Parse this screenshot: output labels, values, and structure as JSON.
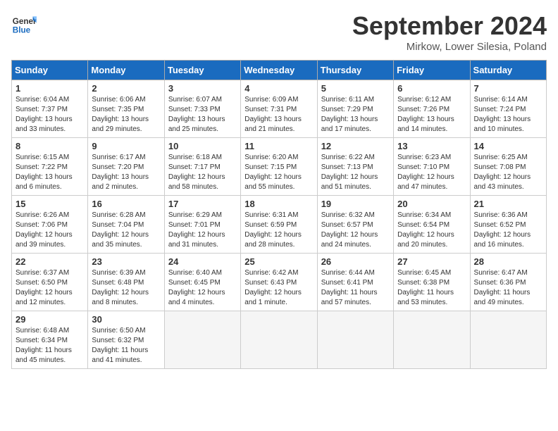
{
  "header": {
    "logo_line1": "General",
    "logo_line2": "Blue",
    "month": "September 2024",
    "location": "Mirkow, Lower Silesia, Poland"
  },
  "weekdays": [
    "Sunday",
    "Monday",
    "Tuesday",
    "Wednesday",
    "Thursday",
    "Friday",
    "Saturday"
  ],
  "weeks": [
    [
      {
        "day": "1",
        "info": "Sunrise: 6:04 AM\nSunset: 7:37 PM\nDaylight: 13 hours\nand 33 minutes."
      },
      {
        "day": "2",
        "info": "Sunrise: 6:06 AM\nSunset: 7:35 PM\nDaylight: 13 hours\nand 29 minutes."
      },
      {
        "day": "3",
        "info": "Sunrise: 6:07 AM\nSunset: 7:33 PM\nDaylight: 13 hours\nand 25 minutes."
      },
      {
        "day": "4",
        "info": "Sunrise: 6:09 AM\nSunset: 7:31 PM\nDaylight: 13 hours\nand 21 minutes."
      },
      {
        "day": "5",
        "info": "Sunrise: 6:11 AM\nSunset: 7:29 PM\nDaylight: 13 hours\nand 17 minutes."
      },
      {
        "day": "6",
        "info": "Sunrise: 6:12 AM\nSunset: 7:26 PM\nDaylight: 13 hours\nand 14 minutes."
      },
      {
        "day": "7",
        "info": "Sunrise: 6:14 AM\nSunset: 7:24 PM\nDaylight: 13 hours\nand 10 minutes."
      }
    ],
    [
      {
        "day": "8",
        "info": "Sunrise: 6:15 AM\nSunset: 7:22 PM\nDaylight: 13 hours\nand 6 minutes."
      },
      {
        "day": "9",
        "info": "Sunrise: 6:17 AM\nSunset: 7:20 PM\nDaylight: 13 hours\nand 2 minutes."
      },
      {
        "day": "10",
        "info": "Sunrise: 6:18 AM\nSunset: 7:17 PM\nDaylight: 12 hours\nand 58 minutes."
      },
      {
        "day": "11",
        "info": "Sunrise: 6:20 AM\nSunset: 7:15 PM\nDaylight: 12 hours\nand 55 minutes."
      },
      {
        "day": "12",
        "info": "Sunrise: 6:22 AM\nSunset: 7:13 PM\nDaylight: 12 hours\nand 51 minutes."
      },
      {
        "day": "13",
        "info": "Sunrise: 6:23 AM\nSunset: 7:10 PM\nDaylight: 12 hours\nand 47 minutes."
      },
      {
        "day": "14",
        "info": "Sunrise: 6:25 AM\nSunset: 7:08 PM\nDaylight: 12 hours\nand 43 minutes."
      }
    ],
    [
      {
        "day": "15",
        "info": "Sunrise: 6:26 AM\nSunset: 7:06 PM\nDaylight: 12 hours\nand 39 minutes."
      },
      {
        "day": "16",
        "info": "Sunrise: 6:28 AM\nSunset: 7:04 PM\nDaylight: 12 hours\nand 35 minutes."
      },
      {
        "day": "17",
        "info": "Sunrise: 6:29 AM\nSunset: 7:01 PM\nDaylight: 12 hours\nand 31 minutes."
      },
      {
        "day": "18",
        "info": "Sunrise: 6:31 AM\nSunset: 6:59 PM\nDaylight: 12 hours\nand 28 minutes."
      },
      {
        "day": "19",
        "info": "Sunrise: 6:32 AM\nSunset: 6:57 PM\nDaylight: 12 hours\nand 24 minutes."
      },
      {
        "day": "20",
        "info": "Sunrise: 6:34 AM\nSunset: 6:54 PM\nDaylight: 12 hours\nand 20 minutes."
      },
      {
        "day": "21",
        "info": "Sunrise: 6:36 AM\nSunset: 6:52 PM\nDaylight: 12 hours\nand 16 minutes."
      }
    ],
    [
      {
        "day": "22",
        "info": "Sunrise: 6:37 AM\nSunset: 6:50 PM\nDaylight: 12 hours\nand 12 minutes."
      },
      {
        "day": "23",
        "info": "Sunrise: 6:39 AM\nSunset: 6:48 PM\nDaylight: 12 hours\nand 8 minutes."
      },
      {
        "day": "24",
        "info": "Sunrise: 6:40 AM\nSunset: 6:45 PM\nDaylight: 12 hours\nand 4 minutes."
      },
      {
        "day": "25",
        "info": "Sunrise: 6:42 AM\nSunset: 6:43 PM\nDaylight: 12 hours\nand 1 minute."
      },
      {
        "day": "26",
        "info": "Sunrise: 6:44 AM\nSunset: 6:41 PM\nDaylight: 11 hours\nand 57 minutes."
      },
      {
        "day": "27",
        "info": "Sunrise: 6:45 AM\nSunset: 6:38 PM\nDaylight: 11 hours\nand 53 minutes."
      },
      {
        "day": "28",
        "info": "Sunrise: 6:47 AM\nSunset: 6:36 PM\nDaylight: 11 hours\nand 49 minutes."
      }
    ],
    [
      {
        "day": "29",
        "info": "Sunrise: 6:48 AM\nSunset: 6:34 PM\nDaylight: 11 hours\nand 45 minutes."
      },
      {
        "day": "30",
        "info": "Sunrise: 6:50 AM\nSunset: 6:32 PM\nDaylight: 11 hours\nand 41 minutes."
      },
      {
        "day": "",
        "info": ""
      },
      {
        "day": "",
        "info": ""
      },
      {
        "day": "",
        "info": ""
      },
      {
        "day": "",
        "info": ""
      },
      {
        "day": "",
        "info": ""
      }
    ]
  ]
}
